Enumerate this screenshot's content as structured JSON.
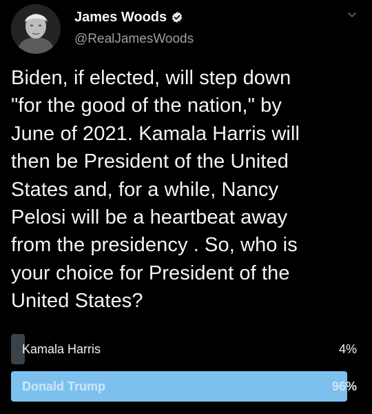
{
  "user": {
    "display_name": "James Woods",
    "handle": "@RealJamesWoods",
    "verified_icon": "verified-badge-icon"
  },
  "tweet": {
    "text": "Biden, if elected, will step down\n\"for the good of the nation,\" by\nJune of 2021. Kamala Harris will\nthen be President of the United\nStates and, for a while, Nancy\nPelosi will be a heartbeat away\nfrom the presidency . So, who is\nyour choice for President of the\nUnited States?"
  },
  "poll": {
    "options": [
      {
        "label": "Kamala Harris",
        "percent": "4%",
        "share": 0.04
      },
      {
        "label": "Donald Trump",
        "percent": "96%",
        "share": 0.96
      }
    ]
  },
  "colors": {
    "background": "#000000",
    "poll_bar": "#3a4248",
    "poll_winner": "#7cc1ee"
  }
}
